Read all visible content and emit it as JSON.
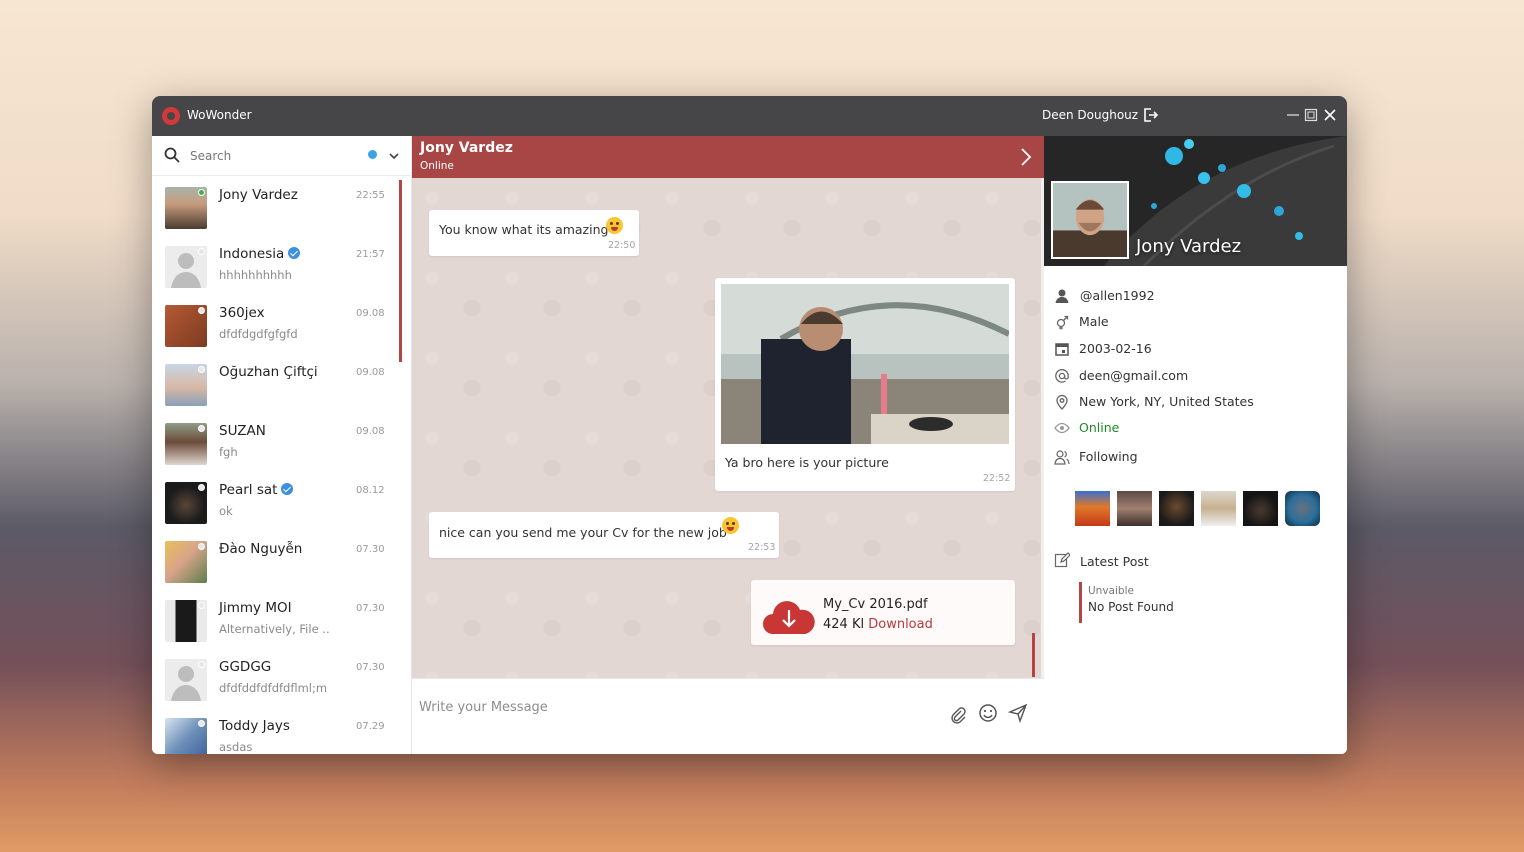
{
  "app": {
    "title": "WoWonder",
    "user_name": "Deen Doughouz"
  },
  "search": {
    "placeholder": "Search"
  },
  "contacts": [
    {
      "name": "Jony Vardez",
      "time": "22:55",
      "message": "",
      "verified": false
    },
    {
      "name": "Indonesia",
      "time": "21:57",
      "message": "hhhhhhhhhh",
      "verified": true
    },
    {
      "name": "360jex",
      "time": "09.08",
      "message": "dfdfdgdfgfgfd",
      "verified": false
    },
    {
      "name": "Oğuzhan Çiftçi",
      "time": "09.08",
      "message": "",
      "verified": false
    },
    {
      "name": "SUZAN",
      "time": "09.08",
      "message": "fgh",
      "verified": false
    },
    {
      "name": "Pearl sat",
      "time": "08.12",
      "message": "ok",
      "verified": true
    },
    {
      "name": "Đào Nguyễn",
      "time": "07.30",
      "message": "",
      "verified": false
    },
    {
      "name": "Jimmy MOI",
      "time": "07.30",
      "message": "Alternatively, File ..",
      "verified": false
    },
    {
      "name": "GGDGG",
      "time": "07.30",
      "message": "dfdfddfdfdfdflml;m",
      "verified": false
    },
    {
      "name": "Toddy Jays",
      "time": "07.29",
      "message": "asdas",
      "verified": false
    }
  ],
  "chat": {
    "name": "Jony Vardez",
    "status": "Online",
    "messages": {
      "m1": {
        "text": "You know what its amazing",
        "time": "22:50"
      },
      "m2": {
        "text": "Ya bro here is your picture",
        "time": "22:52"
      },
      "m3": {
        "text": "nice can you send me your Cv for the new job",
        "time": "22:53"
      },
      "m4": {
        "file_name": "My_Cv 2016.pdf",
        "file_size": "424 Kl",
        "download_label": "Download"
      }
    },
    "composer_placeholder": "Write your Message"
  },
  "profile": {
    "name": "Jony Vardez",
    "username": "@allen1992",
    "gender": "Male",
    "birthday": "2003-02-16",
    "email": "deen@gmail.com",
    "location": "New York, NY, United States",
    "status": "Online",
    "following_label": "Following",
    "latest_post_label": "Latest Post",
    "latest_post_sub": "Unvaible",
    "latest_post_text": "No Post Found"
  },
  "colors": {
    "accent": "#a84646",
    "titlebar": "#464648",
    "online": "#1f8a23",
    "verified": "#3d8fe0"
  }
}
